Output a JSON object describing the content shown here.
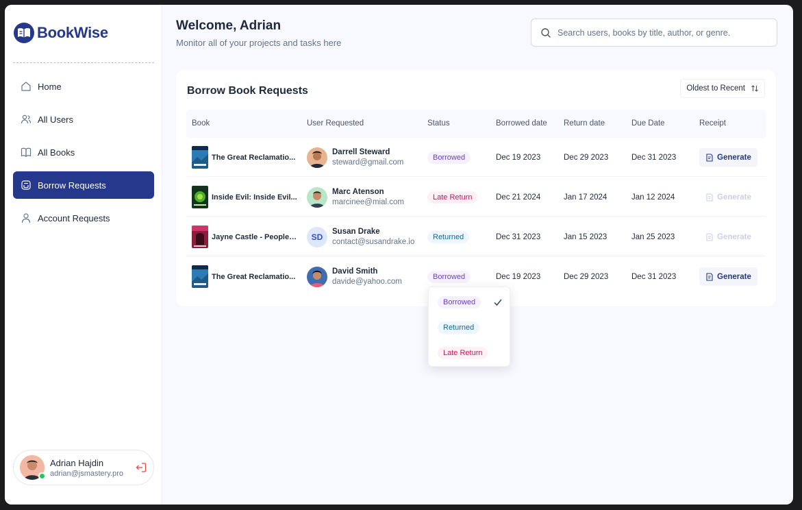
{
  "app": {
    "name": "BookWise"
  },
  "sidebar": {
    "items": [
      {
        "label": "Home",
        "icon": "home-icon",
        "active": false
      },
      {
        "label": "All Users",
        "icon": "users-icon",
        "active": false
      },
      {
        "label": "All Books",
        "icon": "book-icon",
        "active": false
      },
      {
        "label": "Borrow Requests",
        "icon": "borrow-icon",
        "active": true
      },
      {
        "label": "Account Requests",
        "icon": "user-icon",
        "active": false
      }
    ],
    "user": {
      "name": "Adrian Hajdin",
      "email": "adrian@jsmastery.pro"
    }
  },
  "header": {
    "welcome": "Welcome, Adrian",
    "subtitle": "Monitor all of your projects and tasks here",
    "search_placeholder": "Search users, books by title, author, or genre."
  },
  "table": {
    "title": "Borrow Book Requests",
    "sort_label": "Oldest to Recent",
    "columns": [
      "Book",
      "User Requested",
      "Status",
      "Borrowed date",
      "Return date",
      "Due Date",
      "Receipt"
    ],
    "rows": [
      {
        "book": "The Great Reclamatio...",
        "user_name": "Darrell Steward",
        "user_email": "steward@gmail.com",
        "status": "Borrowed",
        "borrowed": "Dec 19 2023",
        "returned": "Dec 29 2023",
        "due": "Dec 31 2023",
        "receipt": "Generate"
      },
      {
        "book": "Inside Evil: Inside Evil...",
        "user_name": "Marc Atenson",
        "user_email": "marcinee@mial.com",
        "status": "Late Return",
        "borrowed": "Dec 21 2024",
        "returned": "Jan 17 2024",
        "due": "Jan 12 2024",
        "receipt": "Generate"
      },
      {
        "book": "Jayne Castle - People i...",
        "user_name": "Susan Drake",
        "user_initials": "SD",
        "user_email": "contact@susandrake.io",
        "status": "Returned",
        "borrowed": "Dec 31 2023",
        "returned": "Jan 15 2023",
        "due": "Jan 25 2023",
        "receipt": "Generate"
      },
      {
        "book": "The Great Reclamatio...",
        "user_name": "David Smith",
        "user_email": "davide@yahoo.com",
        "status": "Borrowed",
        "borrowed": "Dec 19 2023",
        "returned": "Dec 29 2023",
        "due": "Dec 31 2023",
        "receipt": "Generate"
      }
    ]
  },
  "status_dropdown": {
    "options": [
      "Borrowed",
      "Returned",
      "Late Return"
    ],
    "selected": "Borrowed"
  },
  "colors": {
    "brand": "#25388c",
    "borrowed_text": "#6a3ec9",
    "late_text": "#c2185b",
    "returned_text": "#0e6b96",
    "online": "#22c55e"
  }
}
